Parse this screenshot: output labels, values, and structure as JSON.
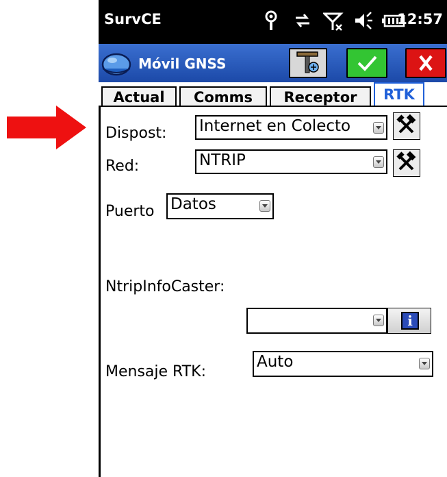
{
  "status_bar": {
    "app_name": "SurvCE",
    "time": "12:57",
    "icons": [
      "antenna-icon",
      "sync-icon",
      "signal-off-icon",
      "volume-icon",
      "battery-icon"
    ]
  },
  "title_bar": {
    "title": "Móvil GNSS",
    "buttons": [
      "settings-icon",
      "check-icon",
      "close-icon"
    ]
  },
  "tabs": [
    {
      "label": "Actual",
      "active": false
    },
    {
      "label": "Comms",
      "active": false
    },
    {
      "label": "Receptor",
      "active": false
    },
    {
      "label": "RTK",
      "active": true
    }
  ],
  "form": {
    "dispositivo": {
      "label": "Dispost:",
      "value": "Internet en Colecto"
    },
    "red": {
      "label": "Red:",
      "value": "NTRIP"
    },
    "puerto": {
      "label": "Puerto",
      "value": "Datos"
    },
    "ntrip_info_caster": {
      "label": "NtripInfoCaster:",
      "value": ""
    },
    "mensaje_rtk": {
      "label": "Mensaje RTK:",
      "value": "Auto"
    }
  },
  "colors": {
    "arrow": "#ee1111",
    "title_bar": "#2a5cc4",
    "active_tab": "#2060d8",
    "ok": "#33c533",
    "close": "#dc1414"
  }
}
